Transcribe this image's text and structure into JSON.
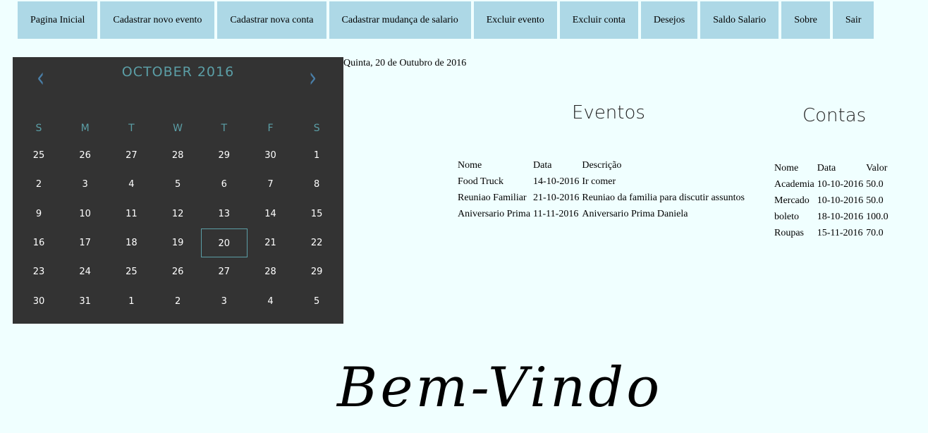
{
  "nav": [
    "Pagina Inicial",
    "Cadastrar novo evento",
    "Cadastrar nova conta",
    "Cadastrar mudança de salario",
    "Excluir evento",
    "Excluir conta",
    "Desejos",
    "Saldo Salario",
    "Sobre",
    "Sair"
  ],
  "calendar": {
    "title": "OCTOBER 2016",
    "prev": "‹",
    "next": "›",
    "weekdays": [
      "S",
      "M",
      "T",
      "W",
      "T",
      "F",
      "S"
    ],
    "days": [
      25,
      26,
      27,
      28,
      29,
      30,
      1,
      2,
      3,
      4,
      5,
      6,
      7,
      8,
      9,
      10,
      11,
      12,
      13,
      14,
      15,
      16,
      17,
      18,
      19,
      20,
      21,
      22,
      23,
      24,
      25,
      26,
      27,
      28,
      29,
      30,
      31,
      1,
      2,
      3,
      4,
      5
    ],
    "selected": 20,
    "accent": "#5b9ea6"
  },
  "current_date": "Quinta, 20 de Outubro de 2016",
  "eventos": {
    "title": "Eventos",
    "headers": [
      "Nome",
      "Data",
      "Descrição"
    ],
    "rows": [
      [
        "Food Truck",
        "14-10-2016",
        "Ir comer"
      ],
      [
        "Reuniao Familiar",
        "21-10-2016",
        "Reuniao da familia para discutir assuntos"
      ],
      [
        "Aniversario Prima",
        "11-11-2016",
        "Aniversario Prima Daniela"
      ]
    ]
  },
  "contas": {
    "title": "Contas",
    "headers": [
      "Nome",
      "Data",
      "Valor"
    ],
    "rows": [
      [
        "Academia",
        "10-10-2016",
        "50.0"
      ],
      [
        "Mercado",
        "10-10-2016",
        "50.0"
      ],
      [
        "boleto",
        "18-10-2016",
        "100.0"
      ],
      [
        "Roupas",
        "15-11-2016",
        "70.0"
      ]
    ]
  },
  "welcome": "Bem-Vindo"
}
